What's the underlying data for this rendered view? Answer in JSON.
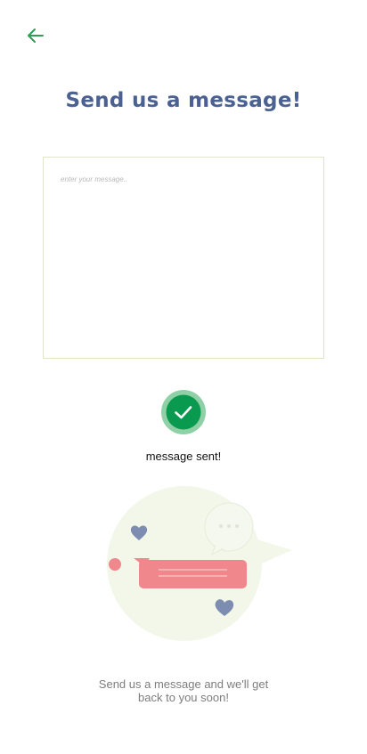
{
  "header": {
    "back_icon": "arrow-left-icon",
    "title": "Send us a message!"
  },
  "message": {
    "placeholder": "enter your message..",
    "value": ""
  },
  "status": {
    "icon": "check-circle-icon",
    "text": "message sent!"
  },
  "illustration": {
    "icon": "chat-bubbles-illustration"
  },
  "footer": {
    "text": "Send us a message and we'll get back to you soon!"
  },
  "colors": {
    "accent_green": "#0a9a4f",
    "title_blue": "#4a6191",
    "bubble_pink": "#f0878c",
    "heart_slate": "#7d8db1"
  }
}
